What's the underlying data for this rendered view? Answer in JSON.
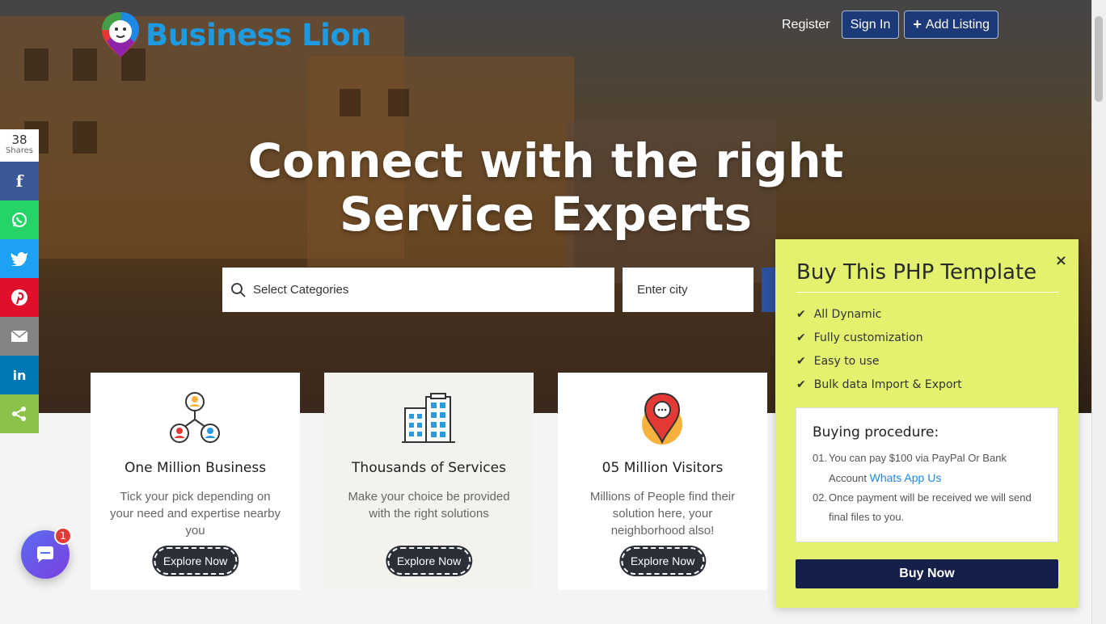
{
  "brand": {
    "name": "Business Lion"
  },
  "nav": {
    "register": "Register",
    "sign_in": "Sign In",
    "add_listing": "Add Listing"
  },
  "hero": {
    "line1": "Connect with the right",
    "line2": "Service Experts"
  },
  "search": {
    "category_placeholder": "Select Categories",
    "city_placeholder": "Enter city"
  },
  "share": {
    "count": "38",
    "label": "Shares",
    "networks": [
      "facebook",
      "whatsapp",
      "twitter",
      "pinterest",
      "email",
      "linkedin",
      "share"
    ]
  },
  "cards": [
    {
      "title": "One Million Business",
      "text": "Tick your pick depending on your need and expertise nearby you",
      "button": "Explore Now"
    },
    {
      "title": "Thousands of Services",
      "text": "Make your choice be provided with the right solutions",
      "button": "Explore Now"
    },
    {
      "title": "05 Million Visitors",
      "text": "Millions of People find their solution here, your neighborhood also!",
      "button": "Explore Now"
    }
  ],
  "chat": {
    "badge": "1"
  },
  "promo": {
    "title": "Buy This PHP Template",
    "close": "×",
    "features": [
      "All Dynamic",
      "Fully customization",
      "Easy to use",
      "Bulk data Import & Export"
    ],
    "procedure_title": "Buying procedure:",
    "steps": [
      {
        "num": "01.",
        "text": "You can pay $100 via PayPal Or Bank Account",
        "link": "Whats App Us"
      },
      {
        "num": "02.",
        "text": "Once payment will be received we will send final files to you."
      }
    ],
    "buy_button": "Buy Now"
  },
  "colors": {
    "brand_blue": "#1e9be0",
    "nav_button": "#1c3a7a",
    "promo_bg": "#e4f16f",
    "buy_button": "#14204a"
  }
}
